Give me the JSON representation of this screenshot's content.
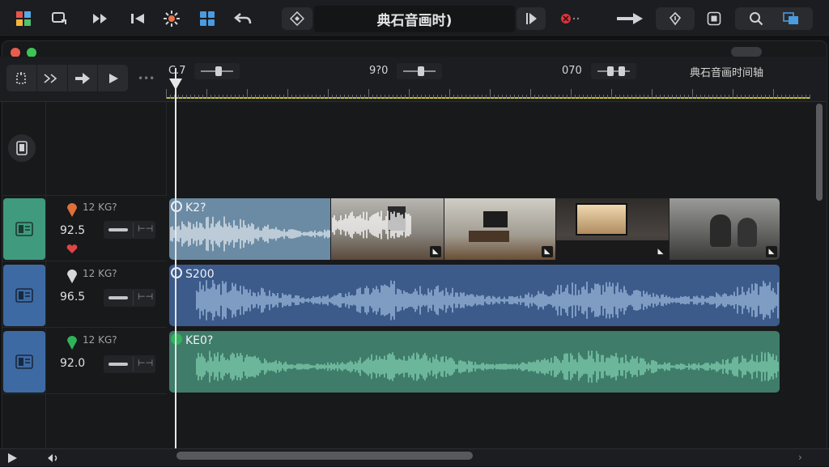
{
  "toolbar": {
    "title": "典石音画时)",
    "icons": [
      "apps-grid-icon",
      "import-media-icon",
      "fast-forward-icon",
      "skip-back-icon",
      "effects-sparkle-icon",
      "layout-grid-icon",
      "undo-icon",
      "snap-diamond-icon",
      "play-in-icon",
      "record-icon",
      "arrow-right-icon",
      "rotate-icon",
      "stop-icon",
      "search-icon",
      "window-icon"
    ]
  },
  "timeline": {
    "label": "典石音画时间轴",
    "timecodes": [
      "C.7",
      "9?0",
      "070"
    ]
  },
  "tracks": [
    {
      "name": "video-track",
      "meta": "12 KG?",
      "volume": "92.5",
      "clip_label": "K2?",
      "color": "#6b8aa3",
      "marker_color": "#e0703a",
      "heart_color": "#e04545",
      "thumbnails": [
        "living-room-scene",
        "living-room-tv-scene",
        "home-theater-scene",
        "conversation-scene"
      ]
    },
    {
      "name": "audio-track-2",
      "meta": "12 KG?",
      "volume": "96.5",
      "clip_label": "S200",
      "color": "#3c5a8a",
      "marker_color": "#d8d8d8"
    },
    {
      "name": "audio-track-3",
      "meta": "12 KG?",
      "volume": "92.0",
      "clip_label": "KE0?",
      "color": "#3f7c6a",
      "marker_color": "#2fb35a"
    }
  ],
  "colors": {
    "accent_yellow": "#c8c234",
    "window_bg": "#18191b"
  }
}
